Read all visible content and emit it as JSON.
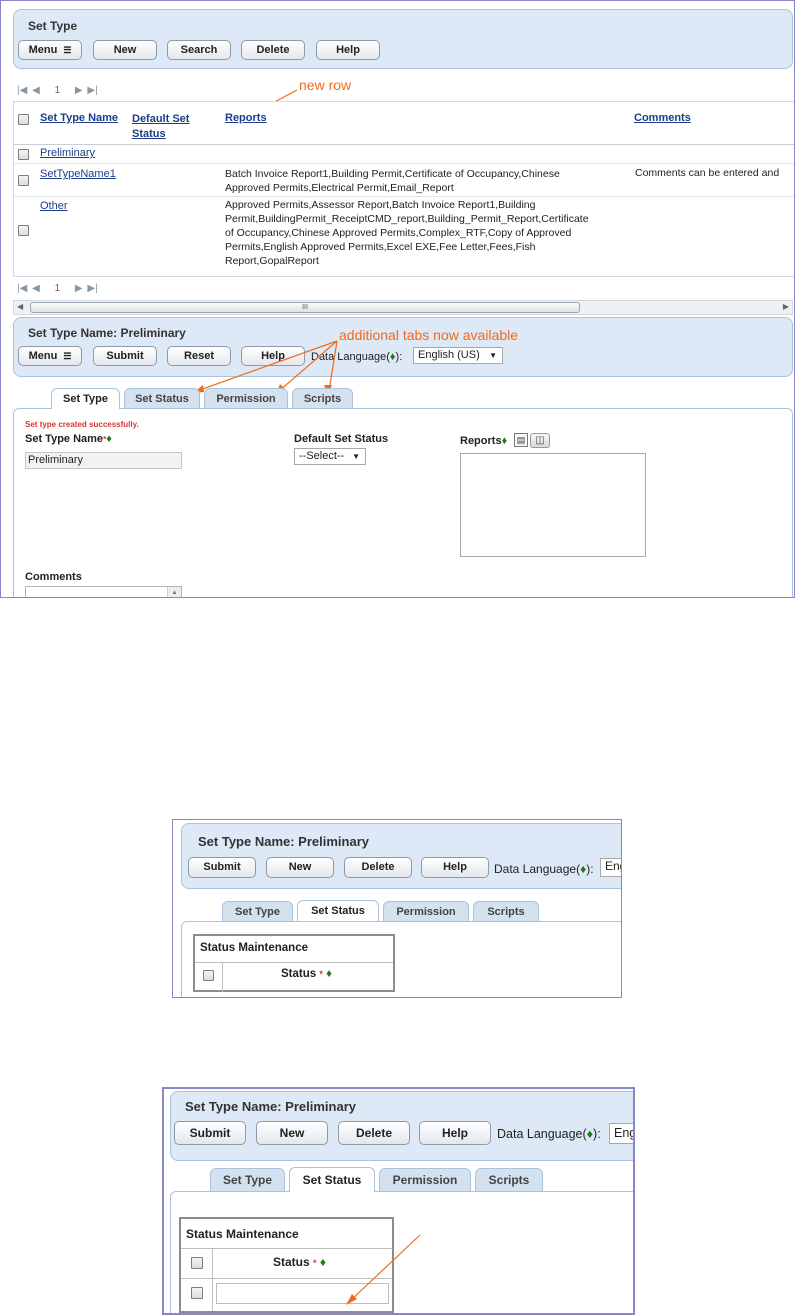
{
  "screen1": {
    "panel_title": "Set Type",
    "toolbar": {
      "menu": "Menu",
      "new": "New",
      "search": "Search",
      "delete": "Delete",
      "help": "Help"
    },
    "pager": {
      "page": "1"
    },
    "annotation_new_row": "new row",
    "columns": {
      "name": "Set Type Name",
      "status_line1": "Default Set",
      "status_line2": "Status",
      "reports": "Reports",
      "comments": "Comments"
    },
    "rows": [
      {
        "name": "Preliminary",
        "reports": [],
        "comments": ""
      },
      {
        "name": "SetTypeName1",
        "reports": [
          "Batch Invoice Report1,Building Permit,Certificate of Occupancy,Chinese",
          "Approved Permits,Electrical Permit,Email_Report"
        ],
        "comments": "Comments can be entered and"
      },
      {
        "name": "Other",
        "reports": [
          "Approved Permits,Assessor Report,Batch Invoice Report1,Building",
          "Permit,BuildingPermit_ReceiptCMD_report,Building_Permit_Report,Certificate",
          "of Occupancy,Chinese Approved Permits,Complex_RTF,Copy of Approved",
          "Permits,English Approved Permits,Excel EXE,Fee Letter,Fees,Fish",
          "Report,GopalReport"
        ],
        "comments": ""
      }
    ],
    "scroll_grip": "III",
    "detail": {
      "title": "Set Type Name: Preliminary",
      "toolbar": {
        "menu": "Menu",
        "submit": "Submit",
        "reset": "Reset",
        "help": "Help"
      },
      "data_language_label": "Data Language(",
      "data_language_suffix": "):",
      "data_language_value": "English (US)",
      "annotation_tabs": "additional tabs now available",
      "tabs": [
        "Set Type",
        "Set Status",
        "Permission",
        "Scripts"
      ],
      "success_message": "Set type created successfully.",
      "set_type_name_label": "Set Type Name",
      "set_type_name_value": "Preliminary",
      "default_status_label": "Default Set Status",
      "default_status_value": "--Select--",
      "reports_label": "Reports",
      "comments_label": "Comments"
    }
  },
  "screen2": {
    "title": "Set Type Name: Preliminary",
    "toolbar": {
      "submit": "Submit",
      "new": "New",
      "delete": "Delete",
      "help": "Help"
    },
    "data_language_label": "Data Language(",
    "data_language_suffix": "):",
    "data_language_value": "Eng",
    "tabs": [
      "Set Type",
      "Set Status",
      "Permission",
      "Scripts"
    ],
    "table_title": "Status Maintenance",
    "status_col": "Status"
  },
  "screen3": {
    "title": "Set Type Name: Preliminary",
    "toolbar": {
      "submit": "Submit",
      "new": "New",
      "delete": "Delete",
      "help": "Help"
    },
    "data_language_label": "Data Language(",
    "data_language_suffix": "):",
    "data_language_value": "Eng",
    "tabs": [
      "Set Type",
      "Set Status",
      "Permission",
      "Scripts"
    ],
    "table_title": "Status Maintenance",
    "status_col": "Status"
  },
  "colors": {
    "accent_orange": "#f26a1b",
    "panel_blue": "#dde9f6",
    "border_purple": "#8a84c8",
    "required_green": "#1d7a1d"
  }
}
